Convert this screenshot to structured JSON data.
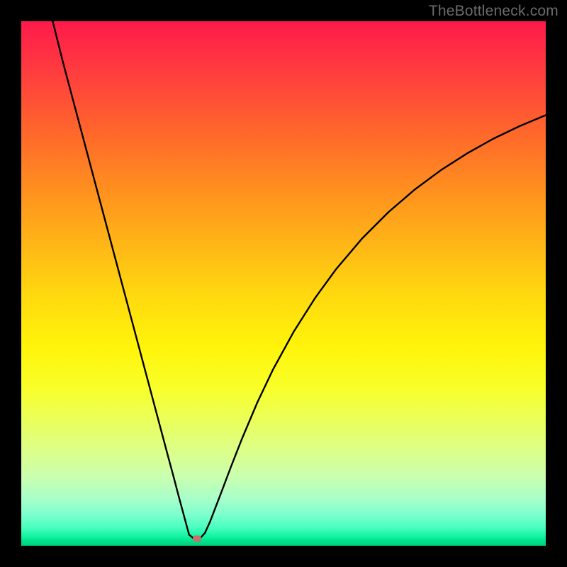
{
  "watermark": "TheBottleneck.com",
  "chart_data": {
    "type": "line",
    "title": "",
    "xlabel": "",
    "ylabel": "",
    "xlim": [
      0,
      100
    ],
    "ylim": [
      0,
      100
    ],
    "grid": false,
    "legend": false,
    "valley_x": 32,
    "marker": {
      "x": 33.5,
      "y": 1.3,
      "color": "#c5736b"
    },
    "series": [
      {
        "name": "bottleneck-curve",
        "color": "#000000",
        "x": [
          6,
          8,
          10,
          12,
          14,
          16,
          18,
          20,
          22,
          24,
          26,
          28,
          29,
          30,
          31,
          32,
          33,
          34,
          35,
          36,
          38,
          40,
          42,
          45,
          48,
          52,
          56,
          60,
          65,
          70,
          75,
          80,
          85,
          90,
          95,
          100
        ],
        "y": [
          100,
          92,
          84.5,
          77,
          69.5,
          62,
          54.5,
          47,
          39.5,
          32,
          24.5,
          17,
          13.3,
          9.5,
          5.8,
          2.1,
          1.3,
          1.3,
          2.4,
          4.6,
          9.8,
          15.1,
          20.2,
          27.3,
          33.6,
          40.9,
          47.2,
          52.7,
          58.6,
          63.6,
          67.9,
          71.6,
          74.8,
          77.6,
          80.0,
          82.1
        ]
      }
    ],
    "gradient_stops": [
      {
        "pos": 0,
        "color": "#ff1a4b"
      },
      {
        "pos": 10,
        "color": "#ff3e3e"
      },
      {
        "pos": 22,
        "color": "#ff6a2a"
      },
      {
        "pos": 32,
        "color": "#ff8f1f"
      },
      {
        "pos": 42,
        "color": "#ffb417"
      },
      {
        "pos": 52,
        "color": "#ffd80f"
      },
      {
        "pos": 62,
        "color": "#fff40a"
      },
      {
        "pos": 70,
        "color": "#f9ff2a"
      },
      {
        "pos": 76,
        "color": "#eaff5a"
      },
      {
        "pos": 82,
        "color": "#dcff8a"
      },
      {
        "pos": 87,
        "color": "#c9ffb0"
      },
      {
        "pos": 91,
        "color": "#a8ffc9"
      },
      {
        "pos": 94,
        "color": "#7effce"
      },
      {
        "pos": 96.5,
        "color": "#4affbf"
      },
      {
        "pos": 98.2,
        "color": "#14f3a3"
      },
      {
        "pos": 99,
        "color": "#00e28e"
      },
      {
        "pos": 100,
        "color": "#00d178"
      }
    ]
  }
}
